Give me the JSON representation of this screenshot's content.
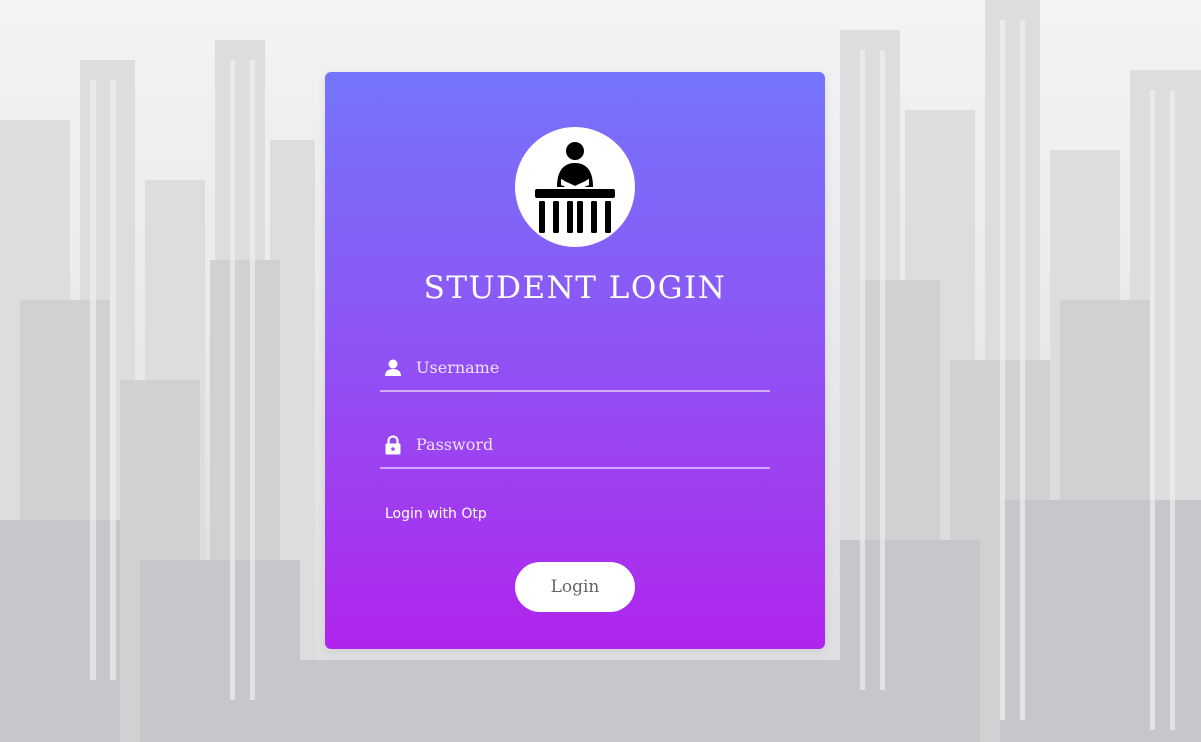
{
  "login": {
    "title": "STUDENT LOGIN",
    "username_placeholder": "Username",
    "password_placeholder": "Password",
    "otp_link": "Login with Otp",
    "submit_label": "Login"
  },
  "icons": {
    "avatar": "student-at-desk-icon",
    "username": "person-icon",
    "password": "lock-icon"
  },
  "colors": {
    "card_gradient_top": "#7474fc",
    "card_gradient_bottom": "#b024ee",
    "button_bg": "#ffffff",
    "button_text": "#666666",
    "text": "#ffffff"
  }
}
